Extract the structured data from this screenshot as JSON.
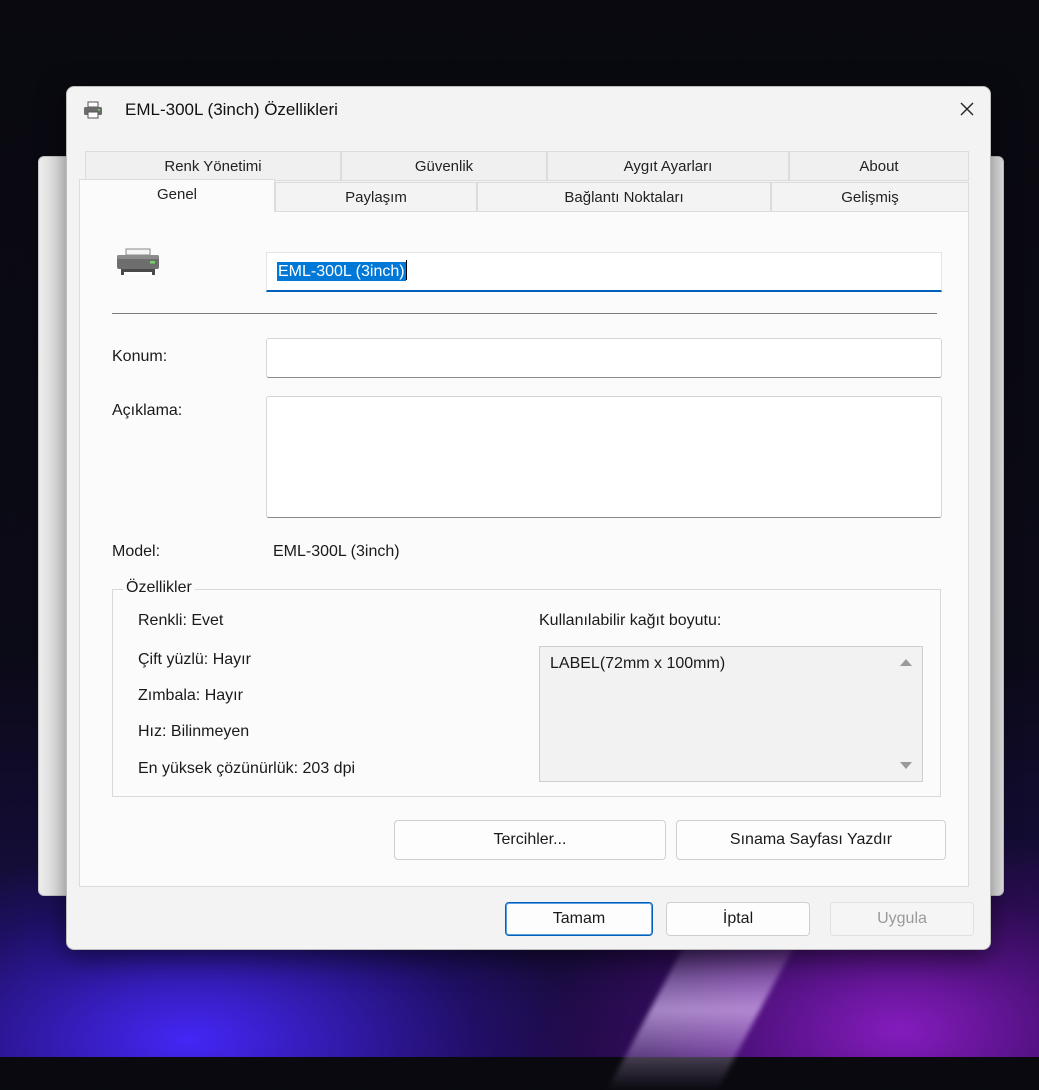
{
  "dialog": {
    "title": "EML-300L (3inch) Özellikleri",
    "close_glyph": "✕"
  },
  "tabs": {
    "row_back": [
      "Renk Yönetimi",
      "Güvenlik",
      "Aygıt Ayarları",
      "About"
    ],
    "row_front": [
      "Genel",
      "Paylaşım",
      "Bağlantı Noktaları",
      "Gelişmiş"
    ],
    "active": "Genel"
  },
  "general": {
    "printer_name": "EML-300L (3inch)",
    "location_label": "Konum:",
    "location_value": "",
    "comment_label": "Açıklama:",
    "comment_value": "",
    "model_label": "Model:",
    "model_value": "EML-300L (3inch)"
  },
  "features": {
    "title": "Özellikler",
    "items": [
      "Renkli: Evet",
      "Çift yüzlü: Hayır",
      "Zımbala: Hayır",
      "Hız: Bilinmeyen",
      "En yüksek çözünürlük: 203 dpi"
    ],
    "paper_label": "Kullanılabilir kağıt boyutu:",
    "paper_sizes": [
      "LABEL(72mm x 100mm)"
    ]
  },
  "buttons": {
    "preferences": "Tercihler...",
    "print_test": "Sınama Sayfası Yazdır",
    "ok": "Tamam",
    "cancel": "İptal",
    "apply": "Uygula"
  },
  "colors": {
    "accent": "#005fb8",
    "selection": "#0078d7"
  },
  "icons": {
    "title": "printer-icon",
    "large": "printer-icon",
    "close": "close-icon"
  }
}
